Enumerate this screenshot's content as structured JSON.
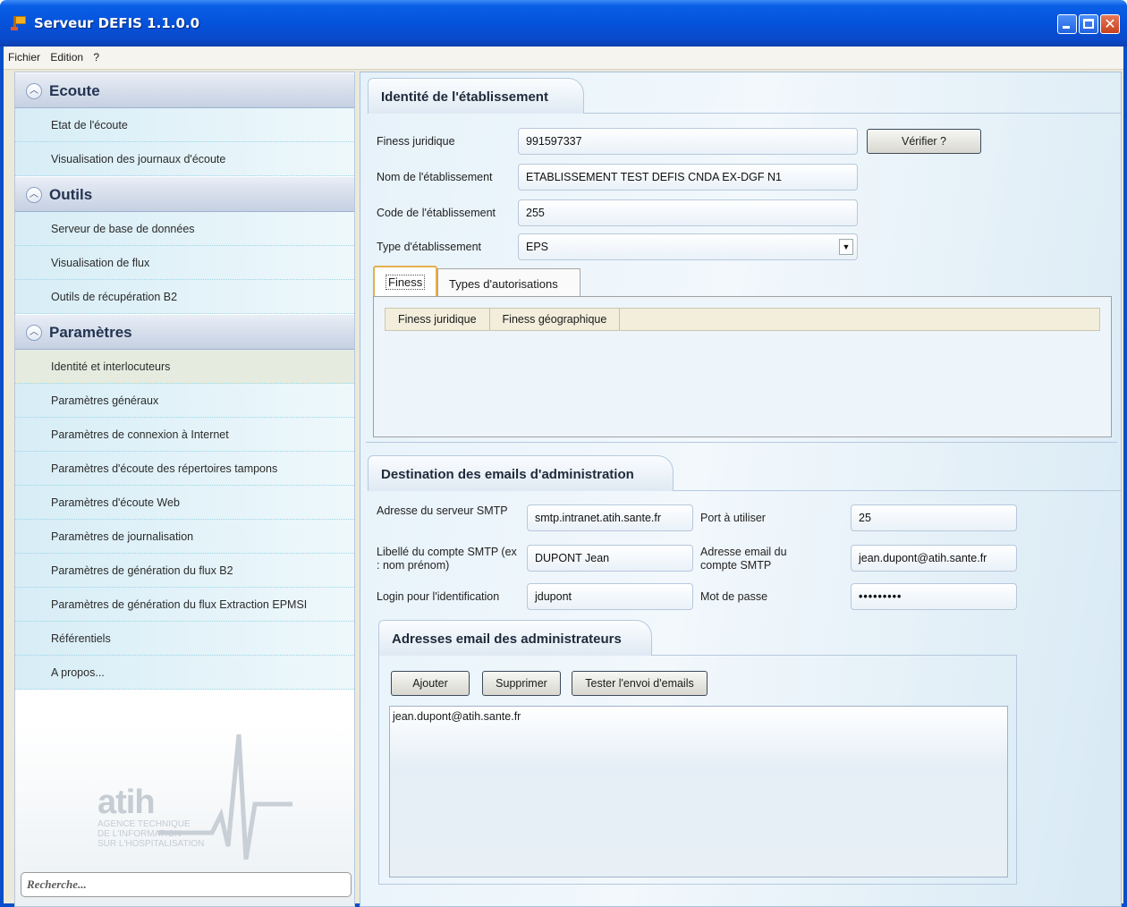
{
  "window": {
    "title": "Serveur DEFIS 1.1.0.0",
    "controls": {
      "minimize": "",
      "maximize": "",
      "close": "✕"
    }
  },
  "menu": [
    "Fichier",
    "Edition",
    "?"
  ],
  "sidebar": {
    "sections": [
      {
        "label": "Ecoute",
        "items": [
          "Etat de l'écoute",
          "Visualisation des journaux d'écoute"
        ]
      },
      {
        "label": "Outils",
        "items": [
          "Serveur de base de données",
          "Visualisation de flux",
          "Outils de récupération B2"
        ]
      },
      {
        "label": "Paramètres",
        "items": [
          "Identité et interlocuteurs",
          "Paramètres généraux",
          "Paramètres de connexion à Internet",
          "Paramètres d'écoute des répertoires tampons",
          "Paramètres d'écoute Web",
          "Paramètres de journalisation",
          "Paramètres de génération du flux B2",
          "Paramètres de génération du flux Extraction EPMSI",
          "Référentiels",
          "A propos..."
        ]
      }
    ],
    "active_item": "Identité et interlocuteurs",
    "logo": {
      "text": "atih",
      "sub": [
        "AGENCE TECHNIQUE",
        "DE L'INFORMATION",
        "SUR L'HOSPITALISATION"
      ]
    },
    "search_placeholder": "Recherche..."
  },
  "identite": {
    "title": "Identité de l'établissement",
    "finess_label": "Finess juridique",
    "finess_value": "991597337",
    "verify_button": "Vérifier ?",
    "nom_label": "Nom de l'établissement",
    "nom_value": "ETABLISSEMENT TEST DEFIS CNDA EX-DGF N1",
    "code_label": "Code de l'établissement",
    "code_value": "255",
    "type_label": "Type d'établissement",
    "type_value": "EPS",
    "tabs": [
      "Finess",
      "Types d'autorisations"
    ],
    "grid_columns": [
      "Finess juridique",
      "Finess géographique"
    ]
  },
  "emails": {
    "title": "Destination des emails d'administration",
    "smtp_label": "Adresse du serveur SMTP",
    "smtp_value": "smtp.intranet.atih.sante.fr",
    "port_label": "Port à utiliser",
    "port_value": "25",
    "compte_label": "Libellé du compte SMTP (ex : nom prénom)",
    "compte_value": "DUPONT Jean",
    "email_label": "Adresse email du compte SMTP",
    "email_value": "jean.dupont@atih.sante.fr",
    "login_label": "Login pour l'identification",
    "login_value": "jdupont",
    "password_label": "Mot de passe",
    "password_value": "•••••••••",
    "admins": {
      "title": "Adresses email des administrateurs",
      "buttons": {
        "add": "Ajouter",
        "remove": "Supprimer",
        "test": "Tester l'envoi d'emails"
      },
      "list": [
        "jean.dupont@atih.sante.fr"
      ]
    }
  }
}
